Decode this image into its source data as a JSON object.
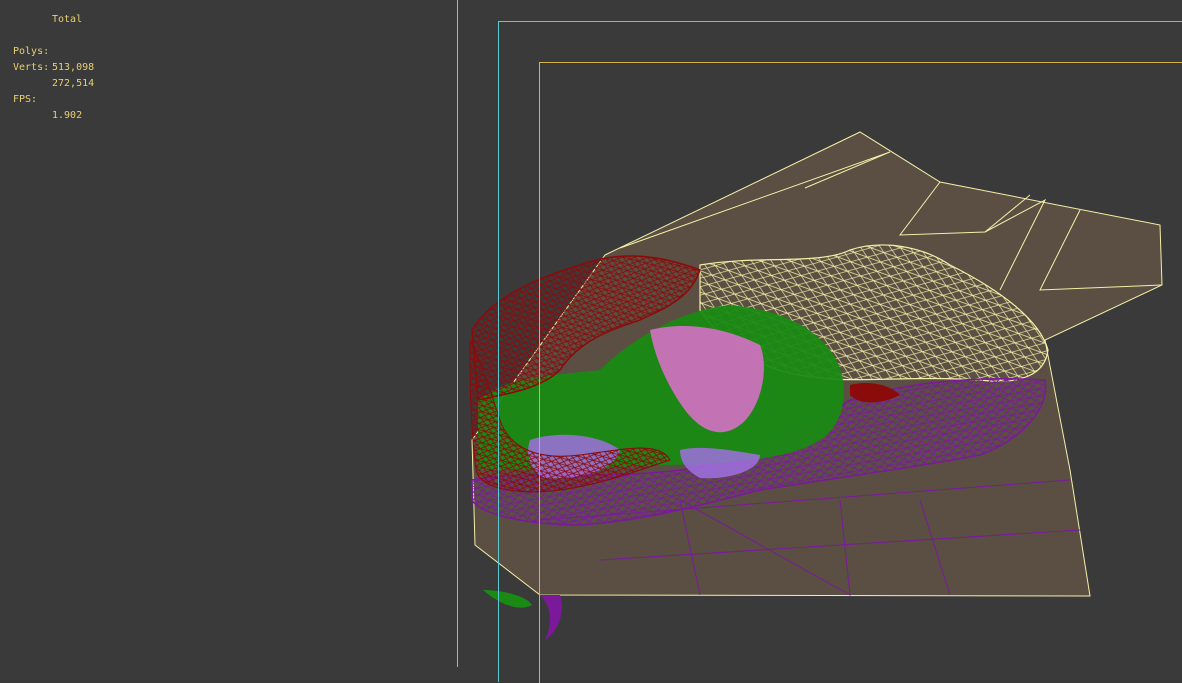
{
  "stats": {
    "header": "Total",
    "polys_label": "Polys:",
    "polys_value": "513,098",
    "verts_label": "Verts:",
    "verts_value": "272,514",
    "fps_label": "FPS:",
    "fps_value": "1.902"
  },
  "colors": {
    "background": "#3a3a3a",
    "stats_text": "#e8d070",
    "safe_frame_outer": "#d4b44a",
    "safe_frame_action": "#5ec8d0",
    "ground_surface": "#5a4f42",
    "wire_yellow": "#f4f0a8",
    "wire_red": "#8b0a0a",
    "wire_green": "#1a8a14",
    "wire_pink": "#e070d0",
    "wire_purple": "#7a1a9a",
    "wire_lilac": "#a070e0"
  }
}
